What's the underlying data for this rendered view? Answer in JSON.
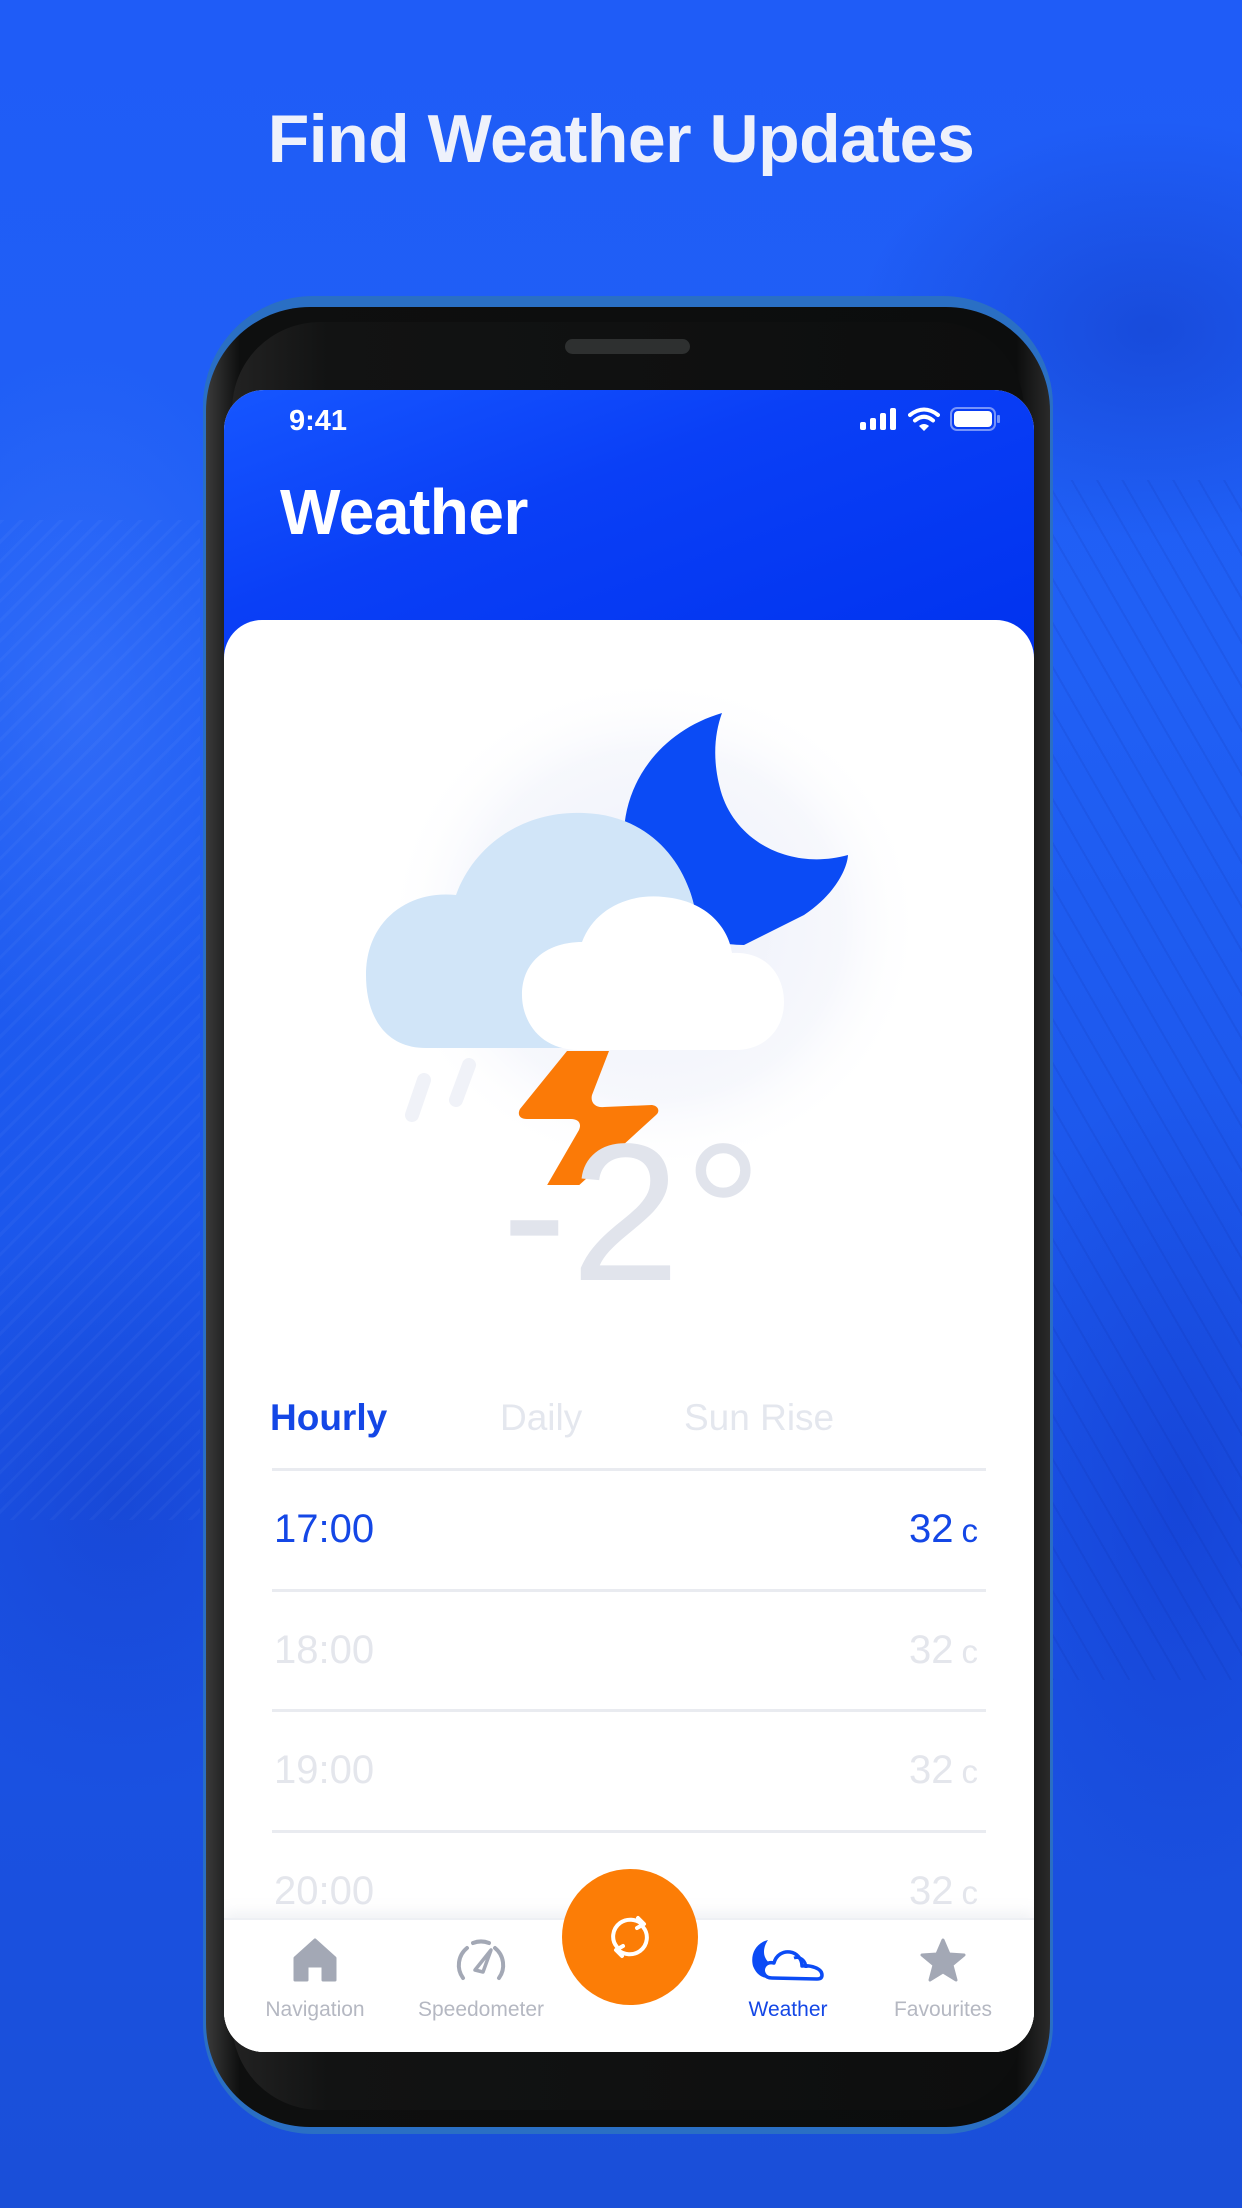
{
  "promo": {
    "title": "Find Weather Updates"
  },
  "status_bar": {
    "time": "9:41",
    "icons": [
      "cellular-signal-icon",
      "wifi-icon",
      "battery-icon"
    ]
  },
  "header": {
    "title": "Weather"
  },
  "current": {
    "condition_icon": "night-thunderstorm-icon",
    "temperature": "-2°"
  },
  "tabs": [
    {
      "label": "Hourly",
      "active": true
    },
    {
      "label": "Daily",
      "active": false
    },
    {
      "label": "Sun Rise",
      "active": false
    }
  ],
  "hourly": [
    {
      "time": "17:00",
      "temp": "32",
      "unit": "c",
      "highlighted": true
    },
    {
      "time": "18:00",
      "temp": "32",
      "unit": "c",
      "highlighted": false
    },
    {
      "time": "19:00",
      "temp": "32",
      "unit": "c",
      "highlighted": false
    },
    {
      "time": "20:00",
      "temp": "32",
      "unit": "c",
      "highlighted": false
    }
  ],
  "bottom_nav": {
    "items": [
      {
        "label": "Navigation",
        "icon": "home-icon",
        "active": false
      },
      {
        "label": "Speedometer",
        "icon": "speedometer-icon",
        "active": false
      },
      {
        "label": "Weather",
        "icon": "weather-icon",
        "active": true
      },
      {
        "label": "Favourites",
        "icon": "star-icon",
        "active": false
      }
    ],
    "fab_icon": "refresh-icon"
  },
  "colors": {
    "primary": "#1447e6",
    "header_blue": "#0a3ff6",
    "accent_orange": "#fc7d06",
    "moon_blue": "#0b4bf5",
    "cloud_back": "#d1e5f8",
    "inactive_gray": "#b5b8c2",
    "dim_text": "#e4e6ec"
  }
}
